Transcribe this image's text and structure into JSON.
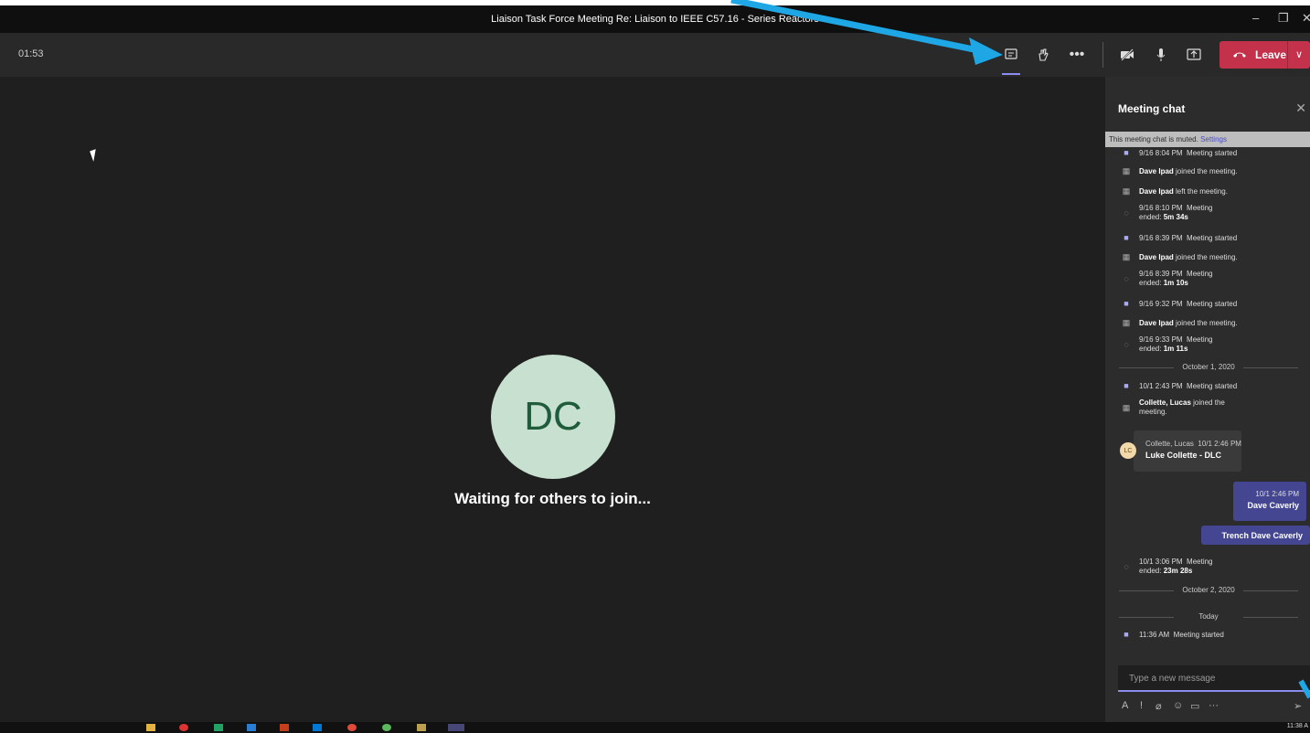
{
  "window": {
    "title": "Liaison Task Force Meeting Re: Liaison to IEEE C57.16 - Series Reactors"
  },
  "toolbar": {
    "timer": "01:53",
    "leave_label": "Leave"
  },
  "stage": {
    "avatar_initials": "DC",
    "waiting_text": "Waiting for others to join..."
  },
  "chat": {
    "title": "Meeting chat",
    "muted_text": "This meeting chat is muted.",
    "settings_link": "Settings",
    "events": [
      {
        "time": "9/16 8:04 PM",
        "text": "Meeting started"
      },
      {
        "name": "Dave Ipad",
        "text": "joined the meeting."
      },
      {
        "name": "Dave Ipad",
        "text": "left the meeting."
      },
      {
        "time": "9/16 8:10 PM",
        "text": "Meeting",
        "line2": "ended:",
        "duration": "5m 34s"
      },
      {
        "time": "9/16 8:39 PM",
        "text": "Meeting started"
      },
      {
        "name": "Dave Ipad",
        "text": "joined the meeting."
      },
      {
        "time": "9/16 8:39 PM",
        "text": "Meeting",
        "line2": "ended:",
        "duration": "1m 10s"
      },
      {
        "time": "9/16 9:32 PM",
        "text": "Meeting started"
      },
      {
        "name": "Dave Ipad",
        "text": "joined the meeting."
      },
      {
        "time": "9/16 9:33 PM",
        "text": "Meeting",
        "line2": "ended:",
        "duration": "1m 11s"
      },
      {
        "date": "October 1, 2020"
      },
      {
        "time": "10/1 2:43 PM",
        "text": "Meeting started"
      },
      {
        "name": "Collette, Lucas",
        "text": "joined the",
        "line2": "meeting."
      }
    ],
    "message_from": {
      "initials": "LC",
      "sender": "Collette, Lucas",
      "time": "10/1 2:46 PM",
      "text": "Luke Collette - DLC"
    },
    "my_message_1": {
      "time": "10/1 2:46 PM",
      "text": "Dave Caverly"
    },
    "my_message_2": {
      "text": "Trench Dave Caverly"
    },
    "after": [
      {
        "time": "10/1 3:06 PM",
        "text": "Meeting",
        "line2": "ended:",
        "duration": "23m 28s"
      },
      {
        "date": "October 2, 2020"
      },
      {
        "date": "Today"
      },
      {
        "time": "11:36 AM",
        "text": "Meeting started"
      }
    ],
    "compose_placeholder": "Type a new message"
  },
  "taskbar": {
    "clock": "11:38 A"
  },
  "colors": {
    "accent": "#8b8cf0",
    "leave": "#c4314b",
    "annotation_arrow": "#1ea7e4"
  }
}
